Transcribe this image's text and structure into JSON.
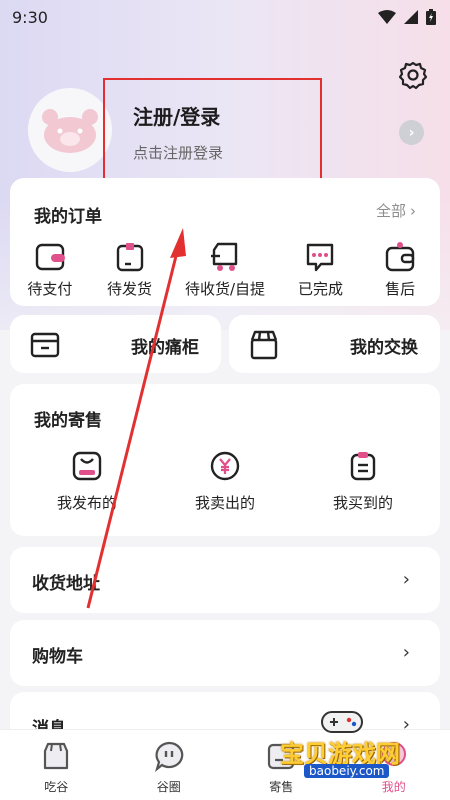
{
  "status_bar": {
    "time": "9:30"
  },
  "profile": {
    "login_title": "注册/登录",
    "login_sub": "点击注册登录"
  },
  "orders": {
    "title": "我的订单",
    "all_label": "全部",
    "items": [
      {
        "label": "待支付",
        "icon": "wallet-card-icon"
      },
      {
        "label": "待发货",
        "icon": "package-box-icon"
      },
      {
        "label": "待收货/自提",
        "icon": "delivery-truck-icon"
      },
      {
        "label": "已完成",
        "icon": "chat-bubble-icon"
      },
      {
        "label": "售后",
        "icon": "refund-wallet-icon"
      }
    ]
  },
  "quick": {
    "cabinet_label": "我的痛柜",
    "exchange_label": "我的交换"
  },
  "consign": {
    "title": "我的寄售",
    "items": [
      {
        "label": "我发布的",
        "icon": "published-bag-icon"
      },
      {
        "label": "我卖出的",
        "icon": "yen-coin-icon"
      },
      {
        "label": "我买到的",
        "icon": "bought-note-icon"
      }
    ]
  },
  "rows": [
    {
      "label": "收货地址"
    },
    {
      "label": "购物车"
    },
    {
      "label": "消息"
    }
  ],
  "nav": {
    "items": [
      {
        "label": "吃谷",
        "icon": "store-icon"
      },
      {
        "label": "谷圈",
        "icon": "chat-circle-icon"
      },
      {
        "label": "寄售",
        "icon": "consign-box-icon"
      },
      {
        "label": "我的",
        "icon": "profile-icon"
      }
    ],
    "active_index": 3
  },
  "watermark": {
    "text": "宝贝游戏网",
    "url": "baobeiy.com"
  },
  "colors": {
    "accent_pink": "#e0508a",
    "annotation_red": "#e1302f"
  }
}
